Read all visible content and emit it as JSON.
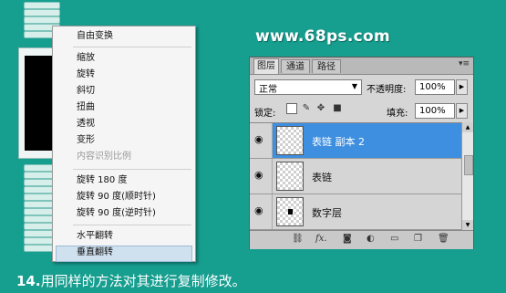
{
  "context_menu": {
    "items": [
      {
        "label": "自由变换"
      },
      {
        "label": "缩放"
      },
      {
        "label": "旋转"
      },
      {
        "label": "斜切"
      },
      {
        "label": "扭曲"
      },
      {
        "label": "透视"
      },
      {
        "label": "变形"
      },
      {
        "label": "内容识别比例"
      },
      {
        "label": "旋转 180 度"
      },
      {
        "label": "旋转 90 度(顺时针)"
      },
      {
        "label": "旋转 90 度(逆时针)"
      },
      {
        "label": "水平翻转"
      },
      {
        "label": "垂直翻转"
      }
    ]
  },
  "watermark": "www.68ps.com",
  "layers_panel": {
    "tabs": [
      "图层",
      "通道",
      "路径"
    ],
    "blend_mode": "正常",
    "opacity_label": "不透明度:",
    "opacity_value": "100%",
    "lock_label": "锁定:",
    "fill_label": "填充:",
    "fill_value": "100%",
    "layers": [
      {
        "name": "表链 副本 2",
        "selected": true
      },
      {
        "name": "表链",
        "selected": false
      },
      {
        "name": "数字层",
        "selected": false
      }
    ]
  },
  "caption": {
    "number": "14.",
    "text": "用同样的方法对其进行复制修改。"
  },
  "colors": {
    "background": "#169e8f",
    "selection": "#3e8fe0"
  }
}
